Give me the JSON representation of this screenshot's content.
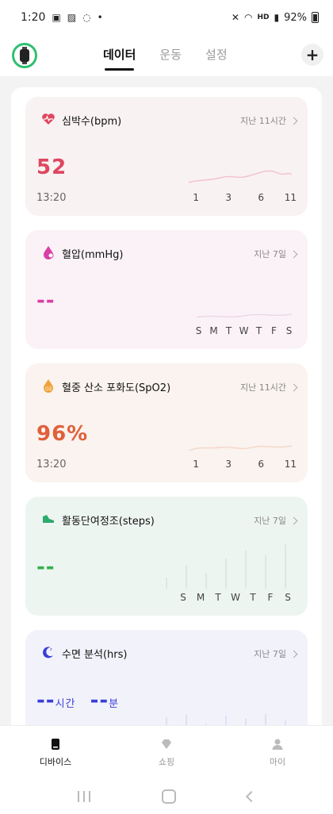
{
  "status_bar": {
    "time": "1:20",
    "battery": "92%",
    "network": "HD"
  },
  "header": {
    "tabs": [
      {
        "label": "데이터",
        "active": true
      },
      {
        "label": "운동",
        "active": false
      },
      {
        "label": "설정",
        "active": false
      }
    ],
    "add_label": "+"
  },
  "cards": {
    "heart_rate": {
      "title": "심박수(bpm)",
      "period": "지난 11시간",
      "value": "52",
      "time": "13:20",
      "axis": [
        "1",
        "3",
        "6",
        "11"
      ],
      "color": "#e0465f"
    },
    "blood_pressure": {
      "title": "혈압(mmHg)",
      "period": "지난 7일",
      "value": "--",
      "axis": [
        "S",
        "M",
        "T",
        "W",
        "T",
        "F",
        "S"
      ],
      "color": "#d93fa5"
    },
    "spo2": {
      "title": "혈중 산소 포화도(SpO2)",
      "period": "지난 11시간",
      "value": "96%",
      "time": "13:20",
      "axis": [
        "1",
        "3",
        "6",
        "11"
      ],
      "color": "#e0603b"
    },
    "steps": {
      "title": "활동단여정조(steps)",
      "period": "지난 7일",
      "value": "--",
      "axis": [
        "S",
        "M",
        "T",
        "W",
        "T",
        "F",
        "S"
      ],
      "color": "#33b04d"
    },
    "sleep": {
      "title": "수면 분석(hrs)",
      "period": "지난 7일",
      "hours_value": "--",
      "hours_unit": "시간",
      "minutes_value": "--",
      "minutes_unit": "분",
      "color": "#3a3fd6"
    }
  },
  "nav": {
    "items": [
      {
        "label": "디바이스",
        "active": true
      },
      {
        "label": "쇼핑",
        "active": false
      },
      {
        "label": "마이",
        "active": false
      }
    ]
  }
}
